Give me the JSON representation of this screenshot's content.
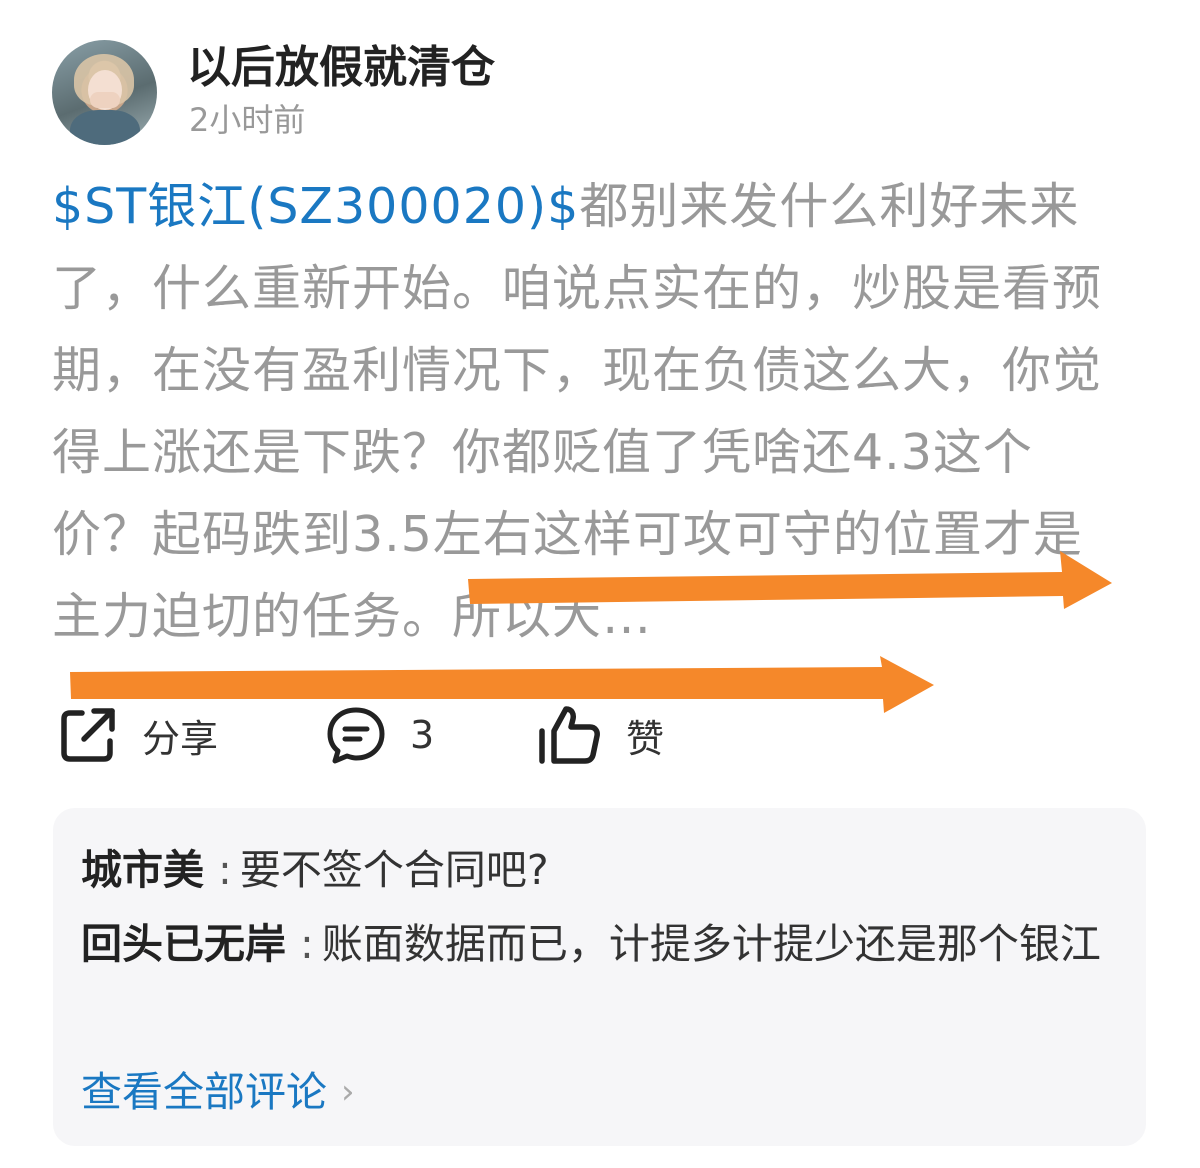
{
  "post": {
    "author": "以后放假就清仓",
    "time": "2小时前",
    "stock_link": "$ST银江(SZ300020)$",
    "content": "都别来发什么利好未来了，什么重新开始。咱说点实在的，炒股是看预期，在没有盈利情况下，现在负债这么大，你觉得上涨还是下跌？你都贬值了凭啥还4.3这个价？起码跌到3.5左右这样可攻可守的位置才是主力迫切的任务。所以大…"
  },
  "actions": {
    "share_label": "分享",
    "comment_count": "3",
    "like_label": "赞"
  },
  "comments": [
    {
      "author": "城市美",
      "text": "要不签个合同吧?"
    },
    {
      "author": "回头已无岸",
      "text": "账面数据而已，计提多计提少还是那个银江"
    }
  ],
  "view_all_comments": "查看全部评论",
  "colors": {
    "link": "#1a78c2",
    "arrow": "#f5882a",
    "body_text": "#999999"
  }
}
